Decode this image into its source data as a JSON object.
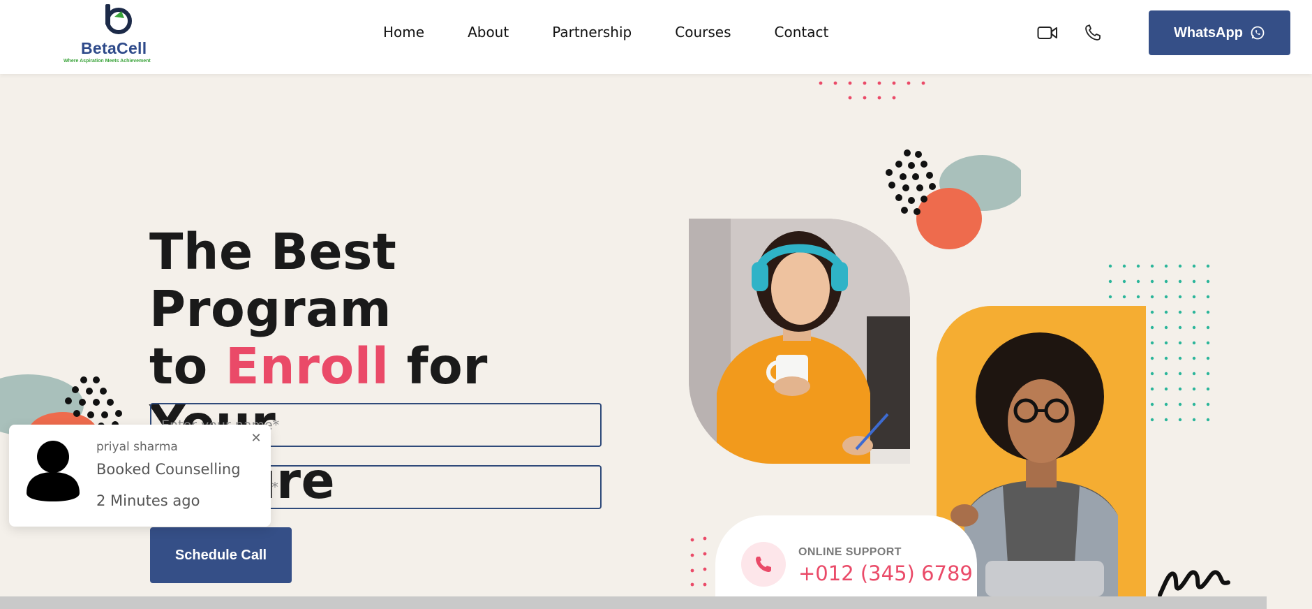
{
  "brand": {
    "name": "BetaCell",
    "tagline": "Where Aspiration Meets Achievement",
    "colors": {
      "primary": "#354f87",
      "accent": "#ea4a68",
      "tagline_green": "#3aa33a",
      "background": "#f4f0ea"
    }
  },
  "nav": {
    "items": [
      {
        "label": "Home"
      },
      {
        "label": "About"
      },
      {
        "label": "Partnership"
      },
      {
        "label": "Courses"
      },
      {
        "label": "Contact"
      }
    ],
    "icons": [
      "video-camera-icon",
      "phone-icon"
    ],
    "whatsapp_label": "WhatsApp"
  },
  "hero": {
    "title_line1": "The Best Program",
    "title_line2_prefix": "to ",
    "title_line2_accent": "Enroll",
    "title_line2_suffix": " for Your",
    "title_line3": "Future",
    "name_placeholder": "Enter your name*",
    "email_placeholder": "Enter your email*",
    "schedule_label": "Schedule Call"
  },
  "notification": {
    "name": "priyal sharma",
    "action": "Booked Counselling",
    "time": "2 Minutes ago",
    "close_icon": "close-icon"
  },
  "support": {
    "label": "ONLINE SUPPORT",
    "phone": "+012 (345) 6789"
  }
}
